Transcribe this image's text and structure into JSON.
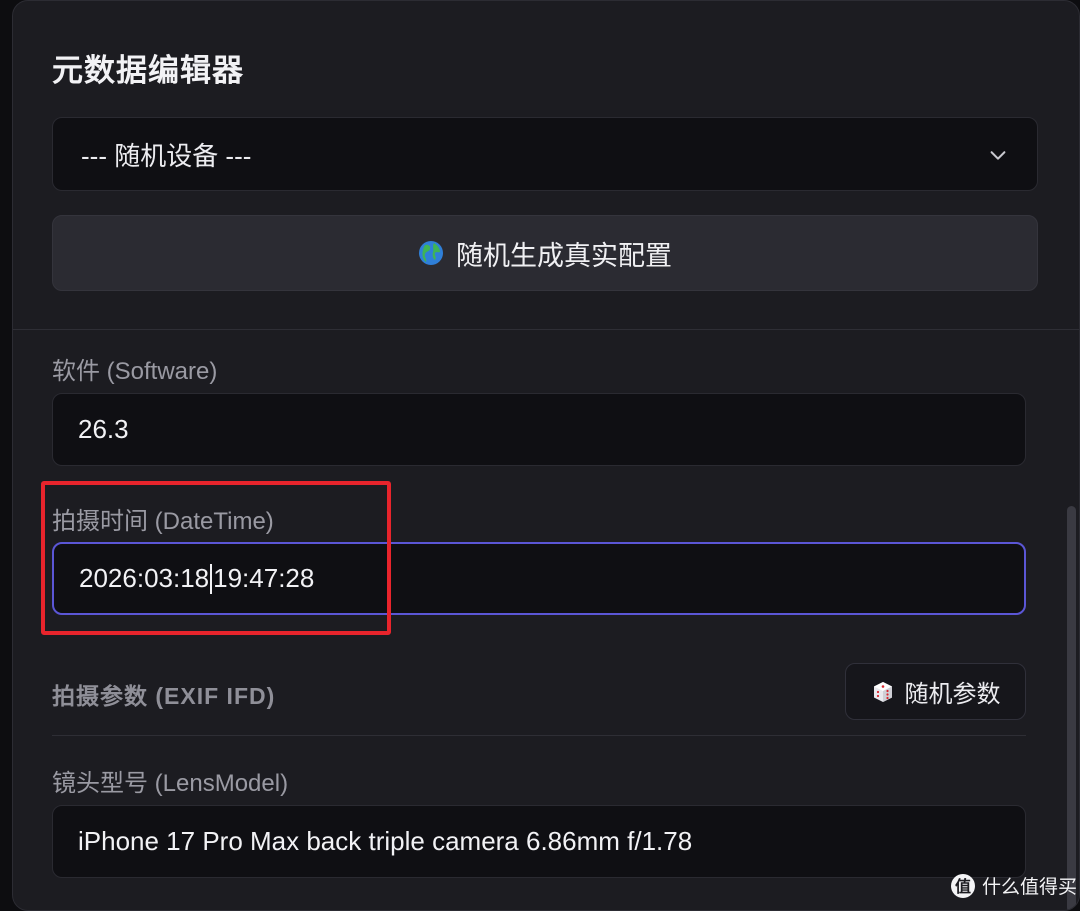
{
  "panel": {
    "title": "元数据编辑器"
  },
  "device_select": {
    "value": "--- 随机设备 ---",
    "icon": "chevron-down-icon"
  },
  "generate_button": {
    "icon": "globe-icon",
    "label": "随机生成真实配置"
  },
  "fields": {
    "software": {
      "label": "软件 (Software)",
      "value": "26.3"
    },
    "datetime": {
      "label": "拍摄时间 (DateTime)",
      "value_before_caret": "2026:03:18",
      "value_after_caret": "19:47:28"
    },
    "lens_model": {
      "label": "镜头型号 (LensModel)",
      "value": "iPhone 17 Pro Max back triple camera 6.86mm f/1.78"
    }
  },
  "exif_section": {
    "title": "拍摄参数 (EXIF IFD)",
    "random_button": {
      "icon": "dice-icon",
      "label": "随机参数"
    }
  },
  "watermark": {
    "text": "什么值得买"
  },
  "colors": {
    "panel_bg": "#1c1c21",
    "input_bg": "#0f0f13",
    "focus_border": "#5b56d6",
    "highlight": "#e8242c"
  }
}
